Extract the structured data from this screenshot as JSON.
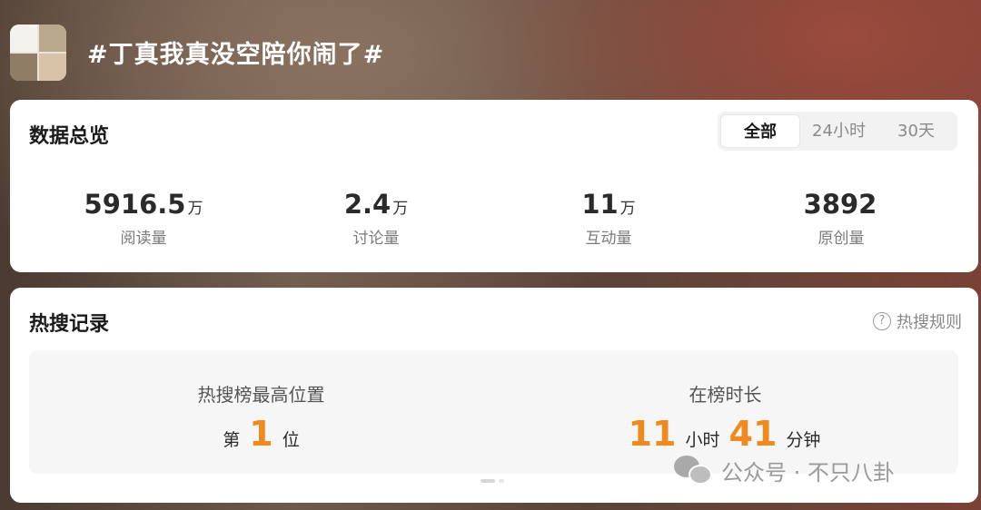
{
  "header": {
    "topic_title": "#丁真我真没空陪你闹了#",
    "avatar_icon": "avatar-collage"
  },
  "overview": {
    "title": "数据总览",
    "tabs": [
      {
        "label": "全部",
        "active": true
      },
      {
        "label": "24小时",
        "active": false
      },
      {
        "label": "30天",
        "active": false
      }
    ],
    "stats": [
      {
        "value": "5916.5",
        "unit": "万",
        "label": "阅读量"
      },
      {
        "value": "2.4",
        "unit": "万",
        "label": "讨论量"
      },
      {
        "value": "11",
        "unit": "万",
        "label": "互动量"
      },
      {
        "value": "3892",
        "unit": "",
        "label": "原创量"
      }
    ]
  },
  "hot": {
    "title": "热搜记录",
    "rules_label": "热搜规则",
    "rules_icon": "?",
    "peak": {
      "label": "热搜榜最高位置",
      "prefix": "第",
      "value": "1",
      "suffix": "位"
    },
    "duration": {
      "label": "在榜时长",
      "hours": "11",
      "hours_unit": "小时",
      "minutes": "41",
      "minutes_unit": "分钟"
    }
  },
  "watermark": {
    "text": "公众号 · 不只八卦",
    "icon": "wechat-icon"
  },
  "colors": {
    "accent_orange": "#ef8a1f",
    "card_bg": "#ffffff",
    "panel_bg": "#f6f6f6"
  }
}
